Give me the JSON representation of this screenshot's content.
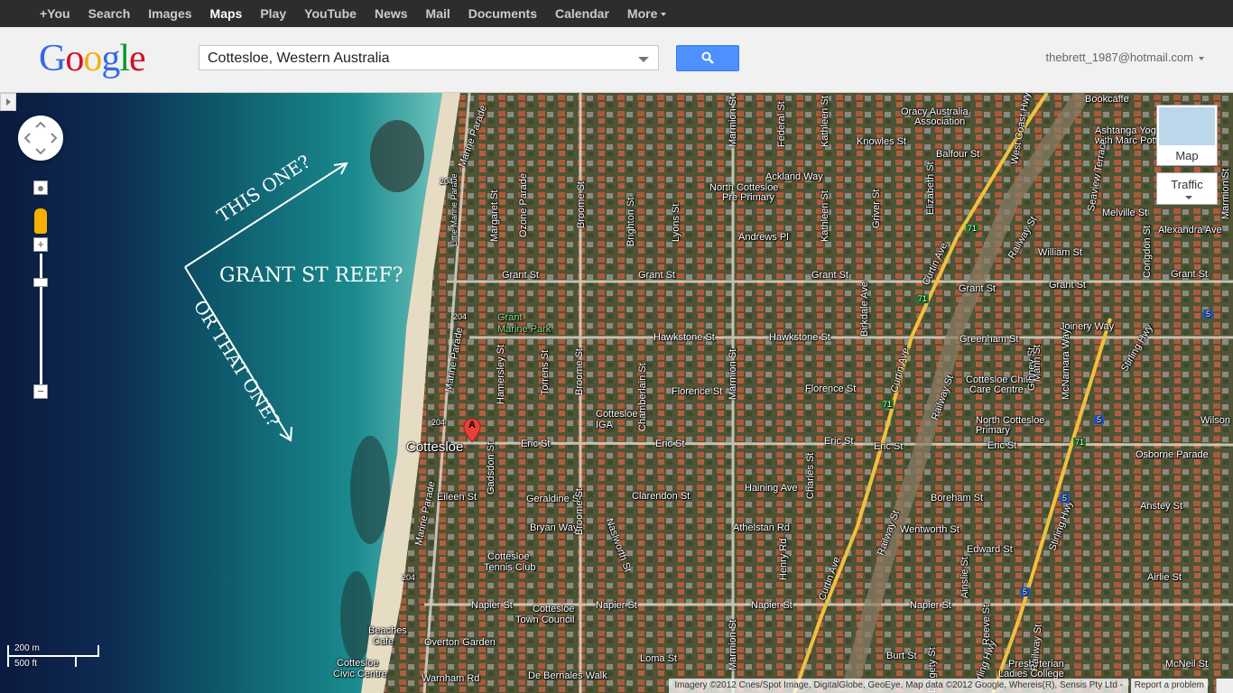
{
  "topbar": {
    "items": [
      "+You",
      "Search",
      "Images",
      "Maps",
      "Play",
      "YouTube",
      "News",
      "Mail",
      "Documents",
      "Calendar",
      "More"
    ],
    "active": "Maps"
  },
  "header": {
    "logo": [
      "G",
      "o",
      "o",
      "g",
      "l",
      "e"
    ],
    "search_value": "Cottesloe, Western Australia",
    "account": "thebrett_1987@hotmail.com"
  },
  "controls": {
    "map_type": "Map",
    "traffic": "Traffic",
    "scale_metric": "200 m",
    "scale_imperial": "500 ft",
    "attribution": "Imagery ©2012 Cnes/Spot Image, DigitalGlobe, GeoEye, Map data ©2012 Google, Whereis(R), Sensis Pty Ltd -",
    "report": "Report a problem"
  },
  "annotations": {
    "this_one": "THIS ONE?",
    "grant_reef": "GRANT ST REEF?",
    "or_that_one": "OR THAT ONE?"
  },
  "map_labels": {
    "marine_parade_1": "Marine Parade",
    "marine_parade_2": "Marine Parade",
    "marine_parade_3": "Marine Parade",
    "little_marine": "Little Marine Parade",
    "margaret_st": "Margaret St",
    "ozone_pde": "Ozone Parade",
    "broome_st_1": "Broome St",
    "broome_st_2": "Broome St",
    "broome_st_3": "Broome St",
    "brighton_st": "Brighton St",
    "lyons_st": "Lyons St",
    "marmion_st_1": "Marmion St",
    "marmion_st_2": "Marmion St",
    "marmion_st_3": "Marmion St",
    "federal_st": "Federal St",
    "kathleen_st_1": "Kathleen St",
    "kathleen_st_2": "Kathleen St",
    "elizabeth_st": "Elizabeth St",
    "grant_st_1": "Grant St",
    "grant_st_2": "Grant St",
    "grant_st_3": "Grant St",
    "grant_st_4": "Grant St",
    "grant_st_5": "Grant St",
    "grant_st_6": "Grant St",
    "grant_park": "Grant",
    "grant_park2": "Marine Park",
    "hawkstone_1": "Hawkstone St",
    "hawkstone_2": "Hawkstone St",
    "florence_1": "Florence St",
    "florence_2": "Florence St",
    "eric_st_1": "Eric St",
    "eric_st_2": "Eric St",
    "eric_st_3": "Eric St",
    "eric_st_4": "Eric St",
    "eric_st_5": "Eric St",
    "cottesloe": "Cottesloe",
    "cottesloe_iga": "Cottesloe",
    "cottesloe_iga2": "IGA",
    "eileen_st": "Eileen St",
    "geraldine_st": "Geraldine St",
    "bryan_way": "Bryan Way",
    "clarendon_st": "Clarendon St",
    "haining_ave": "Haining Ave",
    "athelstan_rd": "Athelstan Rd",
    "napier_st_1": "Napier St",
    "napier_st_2": "Napier St",
    "napier_st_3": "Napier St",
    "napier_st_4": "Napier St",
    "tennis_1": "Cottesloe",
    "tennis_2": "Tennis Club",
    "town_1": "Cottesloe",
    "town_2": "Town Council",
    "beaches_1": "Beaches",
    "beaches_2": "Cafe",
    "overton": "Overton Garden",
    "civic_1": "Cottesloe",
    "civic_2": "Civic Centre",
    "warnham": "Warnham Rd",
    "bernales": "De Bernales Walk",
    "loma_st": "Loma St",
    "burt_st": "Burt St",
    "knowles_st": "Knowles St",
    "balfour_st": "Balfour St",
    "ackland_way": "Ackland Way",
    "north_cott_1": "North Cottesloe",
    "north_cott_2": "Pre Primary",
    "andrews_pl": "Andrews Pl",
    "oracy_1": "Oracy Australia",
    "oracy_2": "Association",
    "curtin_1": "Curtin Ave",
    "curtin_2": "Curtin Ave",
    "curtin_3": "Curtin Ave",
    "railway_1": "Railway St",
    "railway_2": "Railway St",
    "railway_3": "Railway St",
    "william_st": "William St",
    "melville_st": "Melville St",
    "alexandra_ave": "Alexandra Ave",
    "bookcaffe": "Bookcaffe",
    "ashtanga_1": "Ashtanga Yoga",
    "ashtanga_2": "with Marc Potter",
    "joinery_way": "Joinery Way",
    "greenham_st": "Greenham St",
    "childcare_1": "Cottesloe Child",
    "childcare_2": "Care Centre",
    "northprim_1": "North Cottesloe",
    "northprim_2": "Primary",
    "stirling_hwy_1": "Stirling Hwy",
    "stirling_hwy_2": "Stirling Hwy",
    "stirling_hwy_3": "Stirling Hwy",
    "osborne_pde": "Osborne Parade",
    "wilson": "Wilson",
    "boreham_st": "Boreham St",
    "anstey_st": "Anstey St",
    "wentworth_st": "Wentworth St",
    "edward_st": "Edward St",
    "airlie_st": "Airlie St",
    "mcneil_st": "McNeil St",
    "presby_1": "Presbyterian",
    "presby_2": "Ladies College",
    "congdon_st": "Congdon St",
    "west_coast_hwy": "West Coast Hwy",
    "charles_st": "Charles St",
    "henry_rd": "Henry Rd",
    "gibney_st": "Gibney St",
    "birkdale_ave": "Birkdale Ave",
    "griver_st": "Griver St",
    "gadsdon_st": "Gadsdon St",
    "hamersley_st": "Hamersley St",
    "torrens_st": "Torrens St",
    "chamberlain_st": "Chamberlain St",
    "mann_st": "Mann St",
    "mcnamara_way": "McNamara Way",
    "seaview": "Seaview Terrace",
    "marmion_r": "Marmion St",
    "dalgety": "Dalgety St",
    "reeve": "Reeve St",
    "ainslie": "Ainslie St",
    "railway_4": "Railway St",
    "naslworth": "Naslworth St",
    "route_204_1": "204",
    "route_204_2": "204",
    "route_204_3": "204",
    "route_204_4": "204",
    "route_71_1": "71",
    "route_71_2": "71",
    "route_71_3": "71",
    "route_71_4": "71",
    "route_5_1": "5",
    "route_5_2": "5",
    "route_5_3": "5",
    "route_5_4": "5",
    "marker": "A"
  }
}
